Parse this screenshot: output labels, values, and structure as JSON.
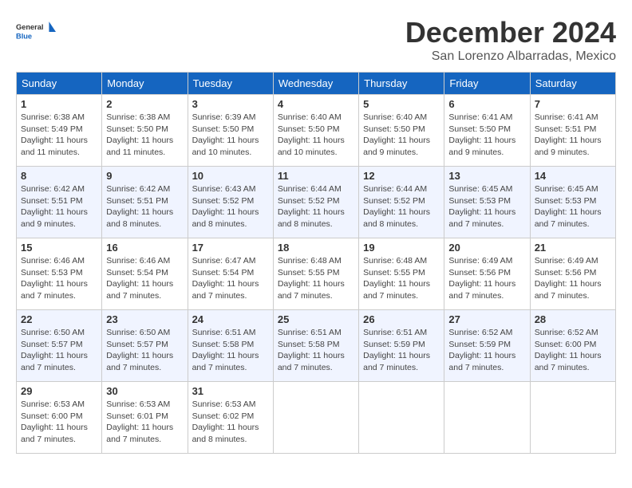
{
  "header": {
    "logo_line1": "General",
    "logo_line2": "Blue",
    "month": "December 2024",
    "location": "San Lorenzo Albarradas, Mexico"
  },
  "weekdays": [
    "Sunday",
    "Monday",
    "Tuesday",
    "Wednesday",
    "Thursday",
    "Friday",
    "Saturday"
  ],
  "weeks": [
    [
      {
        "day": "1",
        "sunrise": "6:38 AM",
        "sunset": "5:49 PM",
        "daylight": "11 hours and 11 minutes."
      },
      {
        "day": "2",
        "sunrise": "6:38 AM",
        "sunset": "5:50 PM",
        "daylight": "11 hours and 11 minutes."
      },
      {
        "day": "3",
        "sunrise": "6:39 AM",
        "sunset": "5:50 PM",
        "daylight": "11 hours and 10 minutes."
      },
      {
        "day": "4",
        "sunrise": "6:40 AM",
        "sunset": "5:50 PM",
        "daylight": "11 hours and 10 minutes."
      },
      {
        "day": "5",
        "sunrise": "6:40 AM",
        "sunset": "5:50 PM",
        "daylight": "11 hours and 9 minutes."
      },
      {
        "day": "6",
        "sunrise": "6:41 AM",
        "sunset": "5:50 PM",
        "daylight": "11 hours and 9 minutes."
      },
      {
        "day": "7",
        "sunrise": "6:41 AM",
        "sunset": "5:51 PM",
        "daylight": "11 hours and 9 minutes."
      }
    ],
    [
      {
        "day": "8",
        "sunrise": "6:42 AM",
        "sunset": "5:51 PM",
        "daylight": "11 hours and 9 minutes."
      },
      {
        "day": "9",
        "sunrise": "6:42 AM",
        "sunset": "5:51 PM",
        "daylight": "11 hours and 8 minutes."
      },
      {
        "day": "10",
        "sunrise": "6:43 AM",
        "sunset": "5:52 PM",
        "daylight": "11 hours and 8 minutes."
      },
      {
        "day": "11",
        "sunrise": "6:44 AM",
        "sunset": "5:52 PM",
        "daylight": "11 hours and 8 minutes."
      },
      {
        "day": "12",
        "sunrise": "6:44 AM",
        "sunset": "5:52 PM",
        "daylight": "11 hours and 8 minutes."
      },
      {
        "day": "13",
        "sunrise": "6:45 AM",
        "sunset": "5:53 PM",
        "daylight": "11 hours and 7 minutes."
      },
      {
        "day": "14",
        "sunrise": "6:45 AM",
        "sunset": "5:53 PM",
        "daylight": "11 hours and 7 minutes."
      }
    ],
    [
      {
        "day": "15",
        "sunrise": "6:46 AM",
        "sunset": "5:53 PM",
        "daylight": "11 hours and 7 minutes."
      },
      {
        "day": "16",
        "sunrise": "6:46 AM",
        "sunset": "5:54 PM",
        "daylight": "11 hours and 7 minutes."
      },
      {
        "day": "17",
        "sunrise": "6:47 AM",
        "sunset": "5:54 PM",
        "daylight": "11 hours and 7 minutes."
      },
      {
        "day": "18",
        "sunrise": "6:48 AM",
        "sunset": "5:55 PM",
        "daylight": "11 hours and 7 minutes."
      },
      {
        "day": "19",
        "sunrise": "6:48 AM",
        "sunset": "5:55 PM",
        "daylight": "11 hours and 7 minutes."
      },
      {
        "day": "20",
        "sunrise": "6:49 AM",
        "sunset": "5:56 PM",
        "daylight": "11 hours and 7 minutes."
      },
      {
        "day": "21",
        "sunrise": "6:49 AM",
        "sunset": "5:56 PM",
        "daylight": "11 hours and 7 minutes."
      }
    ],
    [
      {
        "day": "22",
        "sunrise": "6:50 AM",
        "sunset": "5:57 PM",
        "daylight": "11 hours and 7 minutes."
      },
      {
        "day": "23",
        "sunrise": "6:50 AM",
        "sunset": "5:57 PM",
        "daylight": "11 hours and 7 minutes."
      },
      {
        "day": "24",
        "sunrise": "6:51 AM",
        "sunset": "5:58 PM",
        "daylight": "11 hours and 7 minutes."
      },
      {
        "day": "25",
        "sunrise": "6:51 AM",
        "sunset": "5:58 PM",
        "daylight": "11 hours and 7 minutes."
      },
      {
        "day": "26",
        "sunrise": "6:51 AM",
        "sunset": "5:59 PM",
        "daylight": "11 hours and 7 minutes."
      },
      {
        "day": "27",
        "sunrise": "6:52 AM",
        "sunset": "5:59 PM",
        "daylight": "11 hours and 7 minutes."
      },
      {
        "day": "28",
        "sunrise": "6:52 AM",
        "sunset": "6:00 PM",
        "daylight": "11 hours and 7 minutes."
      }
    ],
    [
      {
        "day": "29",
        "sunrise": "6:53 AM",
        "sunset": "6:00 PM",
        "daylight": "11 hours and 7 minutes."
      },
      {
        "day": "30",
        "sunrise": "6:53 AM",
        "sunset": "6:01 PM",
        "daylight": "11 hours and 7 minutes."
      },
      {
        "day": "31",
        "sunrise": "6:53 AM",
        "sunset": "6:02 PM",
        "daylight": "11 hours and 8 minutes."
      },
      null,
      null,
      null,
      null
    ]
  ]
}
